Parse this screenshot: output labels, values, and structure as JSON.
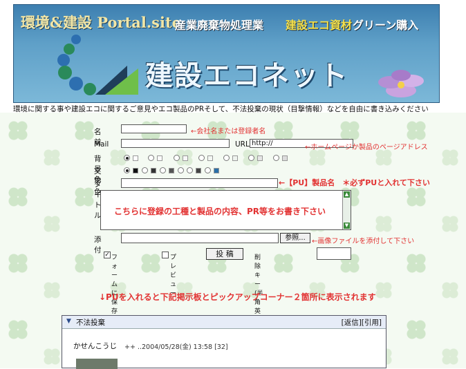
{
  "banner": {
    "title_main": "環境&建設 Portal.site",
    "subtitle_a": "産業廃棄物処理業",
    "subtitle_b": "建設エコ資材",
    "subtitle_c": "グリーン購入",
    "brand": "建設エコネット"
  },
  "intro": "環境に関する事や建設エコに関するご意見やエコ製品のPRそして、不法投棄の現状（目撃情報）などを自由に書き込みください",
  "form": {
    "name_label": "名前",
    "name_note": "←会社名または登録者名",
    "mail_label": "Mail",
    "url_label": "URL",
    "url_value": "http://",
    "url_note": "←ホームページか製品のページアドレス",
    "bg_label": "背景色",
    "text_color_label": "文字色",
    "title_label": "タイトル",
    "title_note": "←【PU】製品名　＊必ずPUと入れて下さい",
    "body_note": "こちらに登録の工種と製品の内容、PR等をお書き下さい",
    "attach_label": "添付",
    "browse_label": "参照...",
    "attach_note": "←画像ファイルを添付して下さい",
    "save_form_label": "フォームに保存",
    "preview_label": "プレビュー",
    "submit_label": "投 稿",
    "delete_key_label": "削除キー(半角英数字)"
  },
  "bottom_note": "↓PUを入れると下記掲示板とピックアップコーナー２箇所に表示されます",
  "board": {
    "title": "不法投棄",
    "actions": "[返信][引用]",
    "author": "かせんこうじ",
    "meta": "++ ..2004/05/28(金) 13:58 [32]"
  },
  "colors": {
    "note_red": "#e23232",
    "banner_blue": "#4a8bb8"
  }
}
